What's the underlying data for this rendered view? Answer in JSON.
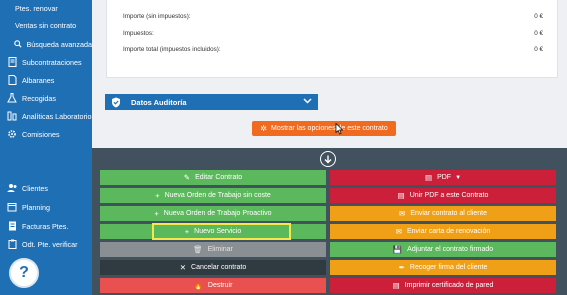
{
  "sidebar": {
    "items": [
      {
        "label": "Ptes. renovar",
        "icon": "none"
      },
      {
        "label": "Ventas sin contrato",
        "icon": "none"
      },
      {
        "label": "Búsqueda avanzada",
        "icon": "search-icon"
      },
      {
        "label": "Subcontrataciones",
        "icon": "document-icon"
      },
      {
        "label": "Albaranes",
        "icon": "file-icon"
      },
      {
        "label": "Recogidas",
        "icon": "flask-icon"
      },
      {
        "label": "Analíticas Laboratorio",
        "icon": "lab-icon"
      },
      {
        "label": "Comisiones",
        "icon": "gear-icon"
      },
      {
        "label": "Clientes",
        "icon": "users-icon"
      },
      {
        "label": "Planning",
        "icon": "calendar-icon"
      },
      {
        "label": "Facturas Ptes.",
        "icon": "invoice-icon"
      },
      {
        "label": "Odt. Pte. verificar",
        "icon": "clipboard-icon"
      }
    ],
    "help_label": "?"
  },
  "summary": {
    "rows": [
      {
        "label": "Importe (sin impuestos):",
        "value": "0 €"
      },
      {
        "label": "Impuestos:",
        "value": "0 €"
      },
      {
        "label": "Importe total (impuestos incluidos):",
        "value": "0 €"
      }
    ]
  },
  "audit": {
    "title": "Datos Auditoría"
  },
  "options_button": {
    "label": "Mostrar las opciones de este contrato"
  },
  "actions": {
    "left": [
      {
        "label": "Editar Contrato",
        "icon": "✎",
        "style": "green"
      },
      {
        "label": "Nueva Orden de Trabajo sin coste",
        "icon": "+",
        "style": "green"
      },
      {
        "label": "Nueva Orden de Trabajo Proactivo",
        "icon": "+",
        "style": "green"
      },
      {
        "label": "Nuevo Servicio",
        "icon": "+",
        "style": "green"
      },
      {
        "label": "Eliminar",
        "icon": "🗑",
        "style": "grey"
      },
      {
        "label": "Cancelar contrato",
        "icon": "✕",
        "style": "dark"
      },
      {
        "label": "Destruir",
        "icon": "🔥",
        "style": "red"
      }
    ],
    "right": [
      {
        "label": "PDF",
        "icon": "▤",
        "style": "crimson",
        "caret": true
      },
      {
        "label": "Unir PDF a este Contrato",
        "icon": "▤",
        "style": "crimson"
      },
      {
        "label": "Enviar contrato al cliente",
        "icon": "✉",
        "style": "amber"
      },
      {
        "label": "Enviar carta de renovación",
        "icon": "✉",
        "style": "amber"
      },
      {
        "label": "Adjuntar el contrato firmado",
        "icon": "💾",
        "style": "green"
      },
      {
        "label": "Recoger firma del cliente",
        "icon": "✒",
        "style": "amber"
      },
      {
        "label": "Imprimir certificado de pared",
        "icon": "▤",
        "style": "crimson"
      }
    ]
  },
  "colors": {
    "sidebar": "#1f6fb5",
    "panel": "#41525e",
    "green": "#5cb85c",
    "amber": "#f0a016",
    "crimson": "#cc1f3a",
    "orange": "#f06a1f"
  }
}
